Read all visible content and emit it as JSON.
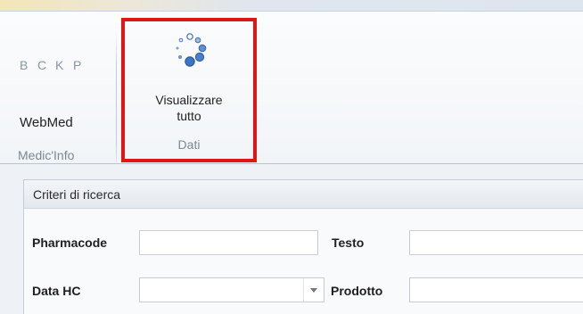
{
  "ribbon": {
    "key_letters": [
      "B",
      "C",
      "K",
      "P"
    ],
    "webmed_label": "WebMed",
    "group_medicinfo_label": "Medic'Info",
    "view_all_button": {
      "line1": "Visualizzare",
      "line2": "tutto",
      "icon": "loading-spinner-icon"
    },
    "group_dati_label": "Dati",
    "highlight_color": "#e01515"
  },
  "search_panel": {
    "title": "Criteri di ricerca",
    "fields": {
      "pharmacode_label": "Pharmacode",
      "testo_label": "Testo",
      "data_hc_label": "Data HC",
      "prodotto_label": "Prodotto"
    }
  }
}
